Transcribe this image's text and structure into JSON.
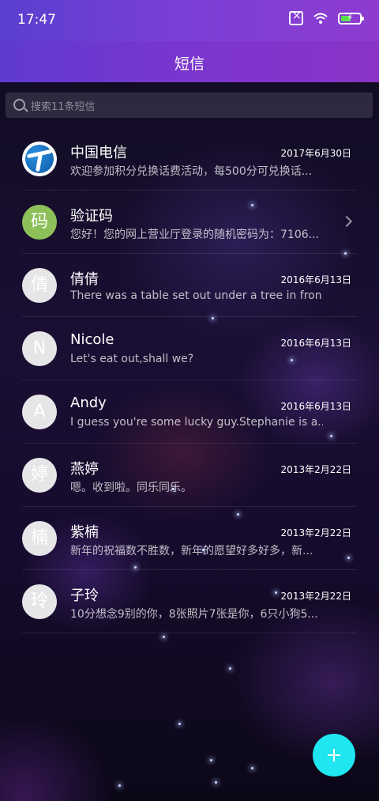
{
  "status_bar": {
    "time": "17:47"
  },
  "header": {
    "title": "短信"
  },
  "search": {
    "placeholder": "搜索11条短信"
  },
  "conversations": [
    {
      "avatar": "",
      "avatar_type": "china-telecom-logo",
      "name": "中国电信",
      "date": "2017年6月30日",
      "preview": "欢迎参加积分兑换话费活动，每500分可兑换话..."
    },
    {
      "avatar": "码",
      "avatar_type": "letter-green",
      "name": "验证码",
      "date": "",
      "preview": "您好！您的网上营业厅登录的随机密码为：7106..."
    },
    {
      "avatar": "倩",
      "avatar_type": "letter",
      "name": "倩倩",
      "date": "2016年6月13日",
      "preview": "There was a table set out under a tree in fron..."
    },
    {
      "avatar": "N",
      "avatar_type": "letter",
      "name": "Nicole",
      "date": "2016年6月13日",
      "preview": "Let's eat out,shall we?"
    },
    {
      "avatar": "A",
      "avatar_type": "letter",
      "name": "Andy",
      "date": "2016年6月13日",
      "preview": "I guess you're some lucky guy.Stephanie is a..."
    },
    {
      "avatar": "婷",
      "avatar_type": "letter",
      "name": "燕婷",
      "date": "2013年2月22日",
      "preview": "嗯。收到啦。同乐同乐。"
    },
    {
      "avatar": "楠",
      "avatar_type": "letter",
      "name": "紫楠",
      "date": "2013年2月22日",
      "preview": "新年的祝福数不胜数，新年的愿望好多好多，新..."
    },
    {
      "avatar": "玲",
      "avatar_type": "letter",
      "name": "子玲",
      "date": "2013年2月22日",
      "preview": "10分想念9别的你，8张照片7张是你，6只小狗5..."
    }
  ],
  "fab": {
    "icon": "plus-icon",
    "color": "#1fe6f0"
  },
  "colors": {
    "header_start": "#5f3ad0",
    "header_end": "#8a33c7",
    "verify_avatar": "#8ec05a"
  }
}
